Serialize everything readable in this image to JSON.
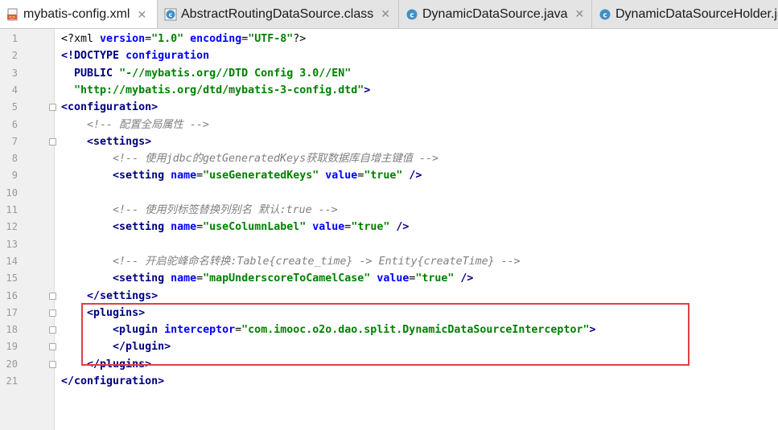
{
  "tabs": [
    {
      "label": "mybatis-config.xml",
      "icon": "xml-file-icon",
      "active": true
    },
    {
      "label": "AbstractRoutingDataSource.class",
      "icon": "class-file-icon",
      "active": false
    },
    {
      "label": "DynamicDataSource.java",
      "icon": "java-class-icon",
      "active": false
    },
    {
      "label": "DynamicDataSourceHolder.java",
      "icon": "java-class-icon",
      "active": false
    }
  ],
  "close_glyph": "✕",
  "line_numbers": [
    "1",
    "2",
    "3",
    "4",
    "5",
    "6",
    "7",
    "8",
    "9",
    "10",
    "11",
    "12",
    "13",
    "14",
    "15",
    "16",
    "17",
    "18",
    "19",
    "20",
    "21"
  ],
  "code_lines": [
    [
      {
        "t": "<?",
        "c": "pi"
      },
      {
        "t": "xml ",
        "c": "pi"
      },
      {
        "t": "version",
        "c": "attr"
      },
      {
        "t": "=",
        "c": "plain"
      },
      {
        "t": "\"1.0\"",
        "c": "val"
      },
      {
        "t": " ",
        "c": "plain"
      },
      {
        "t": "encoding",
        "c": "attr"
      },
      {
        "t": "=",
        "c": "plain"
      },
      {
        "t": "\"UTF-8\"",
        "c": "val"
      },
      {
        "t": "?>",
        "c": "pi"
      }
    ],
    [
      {
        "t": "<!DOCTYPE ",
        "c": "tag"
      },
      {
        "t": "configuration",
        "c": "attr"
      }
    ],
    [
      {
        "t": "  PUBLIC ",
        "c": "tag"
      },
      {
        "t": "\"-//mybatis.org//DTD Config 3.0//EN\"",
        "c": "val"
      }
    ],
    [
      {
        "t": "  \"http://mybatis.org/dtd/mybatis-3-config.dtd\"",
        "c": "val"
      },
      {
        "t": ">",
        "c": "tag"
      }
    ],
    [
      {
        "t": "<configuration>",
        "c": "tag"
      }
    ],
    [
      {
        "t": "    ",
        "c": "plain"
      },
      {
        "t": "<!-- 配置全局属性 -->",
        "c": "com"
      }
    ],
    [
      {
        "t": "    ",
        "c": "plain"
      },
      {
        "t": "<settings>",
        "c": "tag"
      }
    ],
    [
      {
        "t": "        ",
        "c": "plain"
      },
      {
        "t": "<!-- 使用jdbc的getGeneratedKeys获取数据库自增主键值 -->",
        "c": "com"
      }
    ],
    [
      {
        "t": "        ",
        "c": "plain"
      },
      {
        "t": "<setting ",
        "c": "tag"
      },
      {
        "t": "name",
        "c": "attr"
      },
      {
        "t": "=",
        "c": "plain"
      },
      {
        "t": "\"useGeneratedKeys\"",
        "c": "val"
      },
      {
        "t": " ",
        "c": "plain"
      },
      {
        "t": "value",
        "c": "attr"
      },
      {
        "t": "=",
        "c": "plain"
      },
      {
        "t": "\"true\"",
        "c": "val"
      },
      {
        "t": " />",
        "c": "tag"
      }
    ],
    [],
    [
      {
        "t": "        ",
        "c": "plain"
      },
      {
        "t": "<!-- 使用列标签替换列别名 默认:true -->",
        "c": "com"
      }
    ],
    [
      {
        "t": "        ",
        "c": "plain"
      },
      {
        "t": "<setting ",
        "c": "tag"
      },
      {
        "t": "name",
        "c": "attr"
      },
      {
        "t": "=",
        "c": "plain"
      },
      {
        "t": "\"useColumnLabel\"",
        "c": "val"
      },
      {
        "t": " ",
        "c": "plain"
      },
      {
        "t": "value",
        "c": "attr"
      },
      {
        "t": "=",
        "c": "plain"
      },
      {
        "t": "\"true\"",
        "c": "val"
      },
      {
        "t": " />",
        "c": "tag"
      }
    ],
    [],
    [
      {
        "t": "        ",
        "c": "plain"
      },
      {
        "t": "<!-- 开启驼峰命名转换:Table{create_time} -> Entity{createTime} -->",
        "c": "com"
      }
    ],
    [
      {
        "t": "        ",
        "c": "plain"
      },
      {
        "t": "<setting ",
        "c": "tag"
      },
      {
        "t": "name",
        "c": "attr"
      },
      {
        "t": "=",
        "c": "plain"
      },
      {
        "t": "\"mapUnderscoreToCamelCase\"",
        "c": "val"
      },
      {
        "t": " ",
        "c": "plain"
      },
      {
        "t": "value",
        "c": "attr"
      },
      {
        "t": "=",
        "c": "plain"
      },
      {
        "t": "\"true\"",
        "c": "val"
      },
      {
        "t": " />",
        "c": "tag"
      }
    ],
    [
      {
        "t": "    ",
        "c": "plain"
      },
      {
        "t": "</settings>",
        "c": "tag"
      }
    ],
    [
      {
        "t": "    ",
        "c": "plain"
      },
      {
        "t": "<plugins>",
        "c": "tag"
      }
    ],
    [
      {
        "t": "        ",
        "c": "plain"
      },
      {
        "t": "<plugin ",
        "c": "tag"
      },
      {
        "t": "interceptor",
        "c": "attr"
      },
      {
        "t": "=",
        "c": "plain"
      },
      {
        "t": "\"com.imooc.o2o.dao.split.DynamicDataSourceInterceptor\"",
        "c": "val"
      },
      {
        "t": ">",
        "c": "tag"
      }
    ],
    [
      {
        "t": "        ",
        "c": "plain"
      },
      {
        "t": "</plugin>",
        "c": "tag"
      }
    ],
    [
      {
        "t": "    ",
        "c": "plain"
      },
      {
        "t": "</plugins>",
        "c": "tag"
      }
    ],
    [
      {
        "t": "</configuration>",
        "c": "tag"
      }
    ]
  ],
  "colors": {
    "annotation_box": "#e04040",
    "tag": "#000080",
    "attr": "#0000ff",
    "value": "#008000",
    "comment": "#808080"
  }
}
